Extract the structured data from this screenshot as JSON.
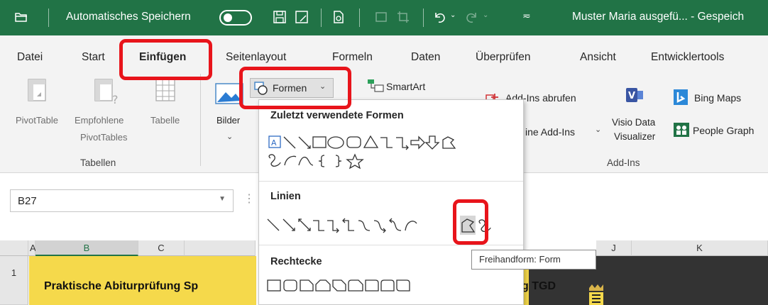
{
  "titlebar": {
    "autosave_label": "Automatisches Speichern",
    "document_title": "Muster Maria ausgefü... - Gespeich",
    "accent_color": "#217346"
  },
  "tabs": [
    {
      "label": "Datei"
    },
    {
      "label": "Start"
    },
    {
      "label": "Einfügen"
    },
    {
      "label": "Seitenlayout"
    },
    {
      "label": "Formeln"
    },
    {
      "label": "Daten"
    },
    {
      "label": "Überprüfen"
    },
    {
      "label": "Ansicht"
    },
    {
      "label": "Entwicklertools"
    }
  ],
  "ribbon": {
    "pivottable": "PivotTable",
    "empfohlene_1": "Empfohlene",
    "empfohlene_2": "PivotTables",
    "tabelle": "Tabelle",
    "group_tabellen": "Tabellen",
    "bilder": "Bilder",
    "formen": "Formen",
    "smartart": "SmartArt",
    "addins_abrufen": "Add-Ins abrufen",
    "meine_addins": "ine Add-Ins",
    "visio_1": "Visio Data",
    "visio_2": "Visualizer",
    "bing_maps": "Bing Maps",
    "people_graph": "People Graph",
    "group_addins": "Add-Ins"
  },
  "namebox": {
    "value": "B27"
  },
  "columns": [
    "A",
    "B",
    "C",
    "J",
    "K"
  ],
  "rows": [
    "1"
  ],
  "cells": {
    "title_left": "Praktische Abiturprüfung Sp",
    "title_right": "g TGD"
  },
  "dropdown": {
    "section_recent": "Zuletzt verwendete Formen",
    "section_lines": "Linien",
    "section_rects": "Rechtecke"
  },
  "tooltip": "Freihandform: Form",
  "colors": {
    "highlight": "#e8141b",
    "yellow": "#f5d94b"
  }
}
